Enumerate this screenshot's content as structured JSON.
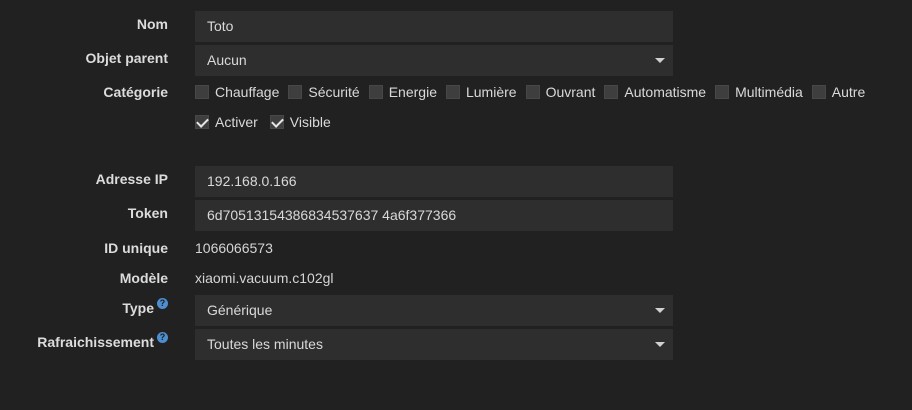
{
  "form": {
    "nom": {
      "label": "Nom",
      "value": "Toto"
    },
    "objet_parent": {
      "label": "Objet parent",
      "value": "Aucun"
    },
    "categorie": {
      "label": "Catégorie",
      "options": [
        {
          "label": "Chauffage",
          "checked": false
        },
        {
          "label": "Sécurité",
          "checked": false
        },
        {
          "label": "Energie",
          "checked": false
        },
        {
          "label": "Lumière",
          "checked": false
        },
        {
          "label": "Ouvrant",
          "checked": false
        },
        {
          "label": "Automatisme",
          "checked": false
        },
        {
          "label": "Multimédia",
          "checked": false
        },
        {
          "label": "Autre",
          "checked": false
        }
      ]
    },
    "activer": {
      "label": "Activer",
      "checked": true
    },
    "visible": {
      "label": "Visible",
      "checked": true
    },
    "adresse_ip": {
      "label": "Adresse IP",
      "value": "192.168.0.166"
    },
    "token": {
      "label": "Token",
      "value": "6d70513154386834537637 4a6f377366"
    },
    "id_unique": {
      "label": "ID unique",
      "value": "1066066573"
    },
    "modele": {
      "label": "Modèle",
      "value": "xiaomi.vacuum.c102gl"
    },
    "type": {
      "label": "Type",
      "value": "Générique",
      "help_icon": "question-circle-icon"
    },
    "rafraichissement": {
      "label": "Rafraichissement",
      "value": "Toutes les minutes",
      "help_icon": "question-circle-icon"
    }
  },
  "colors": {
    "background": "#212121",
    "field_background": "#2e2e2e",
    "help_icon": "#4d8ed0"
  }
}
